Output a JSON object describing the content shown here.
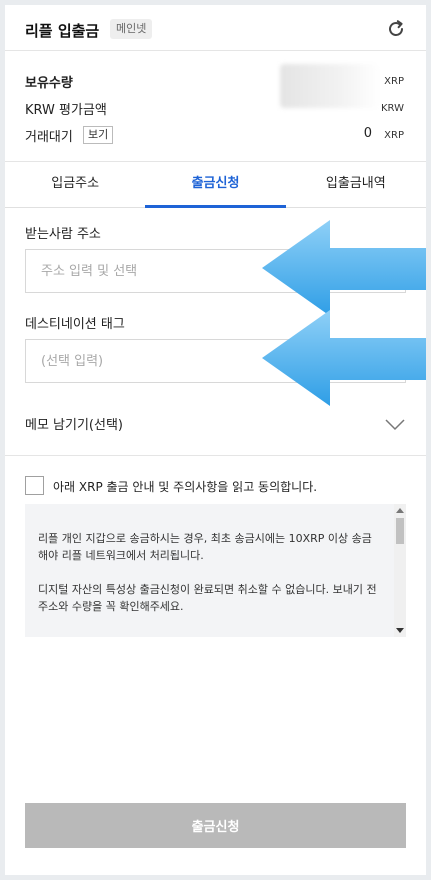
{
  "header": {
    "title": "리플 입출금",
    "network_badge": "메인넷",
    "refresh_icon": "refresh-icon"
  },
  "balance": {
    "holding_label": "보유수량",
    "holding_unit": "XRP",
    "krw_label": "KRW 평가금액",
    "krw_unit": "KRW",
    "pending_label": "거래대기",
    "pending_button": "보기",
    "pending_value": "0",
    "pending_unit": "XRP"
  },
  "tabs": [
    {
      "label": "입금주소",
      "active": false
    },
    {
      "label": "출금신청",
      "active": true
    },
    {
      "label": "입출금내역",
      "active": false
    }
  ],
  "form": {
    "address_label": "받는사람 주소",
    "address_placeholder": "주소 입력 및 선택",
    "tag_label": "데스티네이션 태그",
    "tag_placeholder": "(선택 입력)",
    "memo_label": "메모 남기기(선택)",
    "agree_text": "아래 XRP 출금 안내 및 주의사항을 읽고 동의합니다.",
    "notice_paragraphs": [
      "리플 개인 지갑으로 송금하시는 경우, 최초 송금시에는 10XRP 이상 송금해야 리플 네트워크에서 처리됩니다.",
      "디지털 자산의 특성상 출금신청이 완료되면 취소할 수 없습니다. 보내기 전 주소와 수량을 꼭 확인해주세요."
    ],
    "submit_label": "출금신청"
  },
  "colors": {
    "accent": "#1e63d6",
    "arrow": "#4fb3f0",
    "submit_disabled": "#b9b9b9"
  }
}
